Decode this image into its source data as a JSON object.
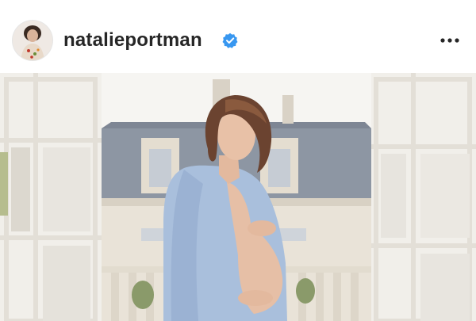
{
  "post": {
    "username": "natalieportman",
    "verified": true,
    "avatar": "profile-photo",
    "more_options_icon": "ellipsis-icon",
    "verified_icon": "verified-badge-icon"
  },
  "colors": {
    "verified_blue": "#3897f0",
    "text_primary": "#262626",
    "shirt_blue": "#a9bfdc"
  }
}
